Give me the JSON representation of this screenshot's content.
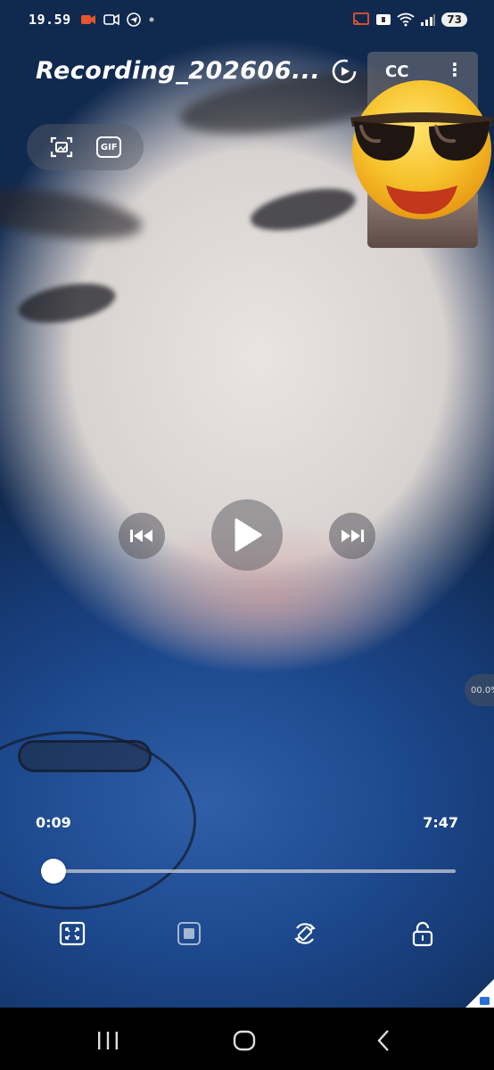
{
  "status_bar": {
    "time": "19.59",
    "battery": "73",
    "icons": [
      "video-record-icon",
      "camera-icon",
      "telegram-icon",
      "dot-icon",
      "cast-icon",
      "notification-icon",
      "wifi-icon",
      "signal-icon",
      "battery-icon"
    ]
  },
  "player": {
    "title": "Recording_202606...",
    "cc_label": "CC",
    "more_label": "⋮",
    "gif_label": "GIF",
    "speed_label": "00.0%",
    "current_time": "0:09",
    "total_time": "7:47",
    "progress_fraction": 0.019
  },
  "colors": {
    "accent": "#ffffff",
    "emoji_yellow": "#f6c12b",
    "emoji_mouth": "#c1381c",
    "video_blue": "#1e4a90"
  },
  "icons": {
    "rotate": "screen-rotate-icon",
    "capture": "capture-frame-icon",
    "gif": "gif-icon",
    "prev": "skip-previous-icon",
    "play": "play-icon",
    "next": "skip-next-icon",
    "fullscreen": "fit-screen-icon",
    "pip": "popup-play-icon",
    "auto_rotate": "auto-rotate-icon",
    "lock": "lock-icon",
    "nav_recents": "recents-icon",
    "nav_home": "home-icon",
    "nav_back": "back-icon"
  }
}
